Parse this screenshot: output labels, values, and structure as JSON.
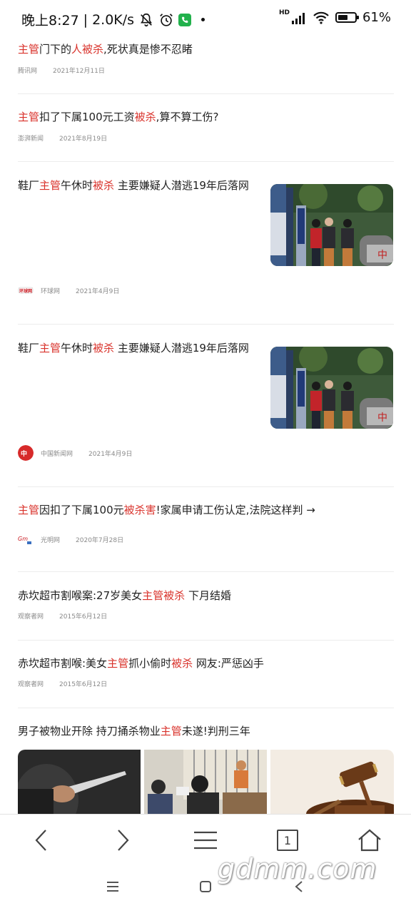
{
  "status_bar": {
    "time": "晚上8:27",
    "separator": "|",
    "net_speed": "2.0K/s",
    "network": "HD",
    "battery": "61%",
    "battery_level": 0.61
  },
  "articles": [
    {
      "title_segments": [
        {
          "t": "主管",
          "hl": true
        },
        {
          "t": "门下的",
          "hl": false
        },
        {
          "t": "人被杀",
          "hl": true
        },
        {
          "t": ",死状真是惨不忍睹",
          "hl": false
        }
      ],
      "source": "腾讯网",
      "date": "2021年12月11日"
    },
    {
      "title_segments": [
        {
          "t": "主管",
          "hl": true
        },
        {
          "t": "扣了下属100元工资",
          "hl": false
        },
        {
          "t": "被杀",
          "hl": true
        },
        {
          "t": ",算不算工伤?",
          "hl": false
        }
      ],
      "source": "澎湃新闻",
      "date": "2021年8月19日"
    },
    {
      "title_segments": [
        {
          "t": "鞋厂",
          "hl": false
        },
        {
          "t": "主管",
          "hl": true
        },
        {
          "t": "午休时",
          "hl": false
        },
        {
          "t": "被杀",
          "hl": true
        },
        {
          "t": " 主要嫌疑人潜逃19年后落网",
          "hl": false
        }
      ],
      "source": "环球网",
      "date": "2021年4月9日",
      "logo": "huanqiu-logo",
      "image": "arrest-photo"
    },
    {
      "title_segments": [
        {
          "t": "鞋厂",
          "hl": false
        },
        {
          "t": "主管",
          "hl": true
        },
        {
          "t": "午休时",
          "hl": false
        },
        {
          "t": "被杀",
          "hl": true
        },
        {
          "t": " 主要嫌疑人潜逃19年后落网",
          "hl": false
        }
      ],
      "source": "中国新闻网",
      "date": "2021年4月9日",
      "logo": "chinanews-logo",
      "image": "arrest-photo"
    },
    {
      "title_segments": [
        {
          "t": "主管",
          "hl": true
        },
        {
          "t": "因扣了下属100元",
          "hl": false
        },
        {
          "t": "被杀害",
          "hl": true
        },
        {
          "t": "!家属申请工伤认定,法院这样判 →",
          "hl": false
        }
      ],
      "source": "光明网",
      "date": "2020年7月28日",
      "logo": "guangming-logo"
    },
    {
      "title_segments": [
        {
          "t": "赤坎超市割喉案:27岁美女",
          "hl": false
        },
        {
          "t": "主管被杀",
          "hl": true
        },
        {
          "t": " 下月结婚",
          "hl": false
        }
      ],
      "source": "观察者网",
      "date": "2015年6月12日"
    },
    {
      "title_segments": [
        {
          "t": "赤坎超市割喉:美女",
          "hl": false
        },
        {
          "t": "主管",
          "hl": true
        },
        {
          "t": "抓小偷时",
          "hl": false
        },
        {
          "t": "被杀",
          "hl": true
        },
        {
          "t": " 网友:严惩凶手",
          "hl": false
        }
      ],
      "source": "观察者网",
      "date": "2015年6月12日"
    },
    {
      "title_segments": [
        {
          "t": "男子被物业开除 持刀捅杀物业",
          "hl": false
        },
        {
          "t": "主管",
          "hl": true
        },
        {
          "t": "未遂!判刑三年",
          "hl": false
        }
      ],
      "images": [
        "knife-photo",
        "courtroom-photo",
        "gavel-photo"
      ]
    }
  ],
  "nav": {
    "back_icon": "chevron-left-icon",
    "forward_icon": "chevron-right-icon",
    "menu_icon": "menu-icon",
    "tabs_count": "1",
    "home_icon": "home-icon"
  },
  "watermark": "gdmm.com",
  "colors": {
    "highlight": "#d9322b",
    "meta": "#8a8a8a",
    "divider": "#ececec"
  }
}
